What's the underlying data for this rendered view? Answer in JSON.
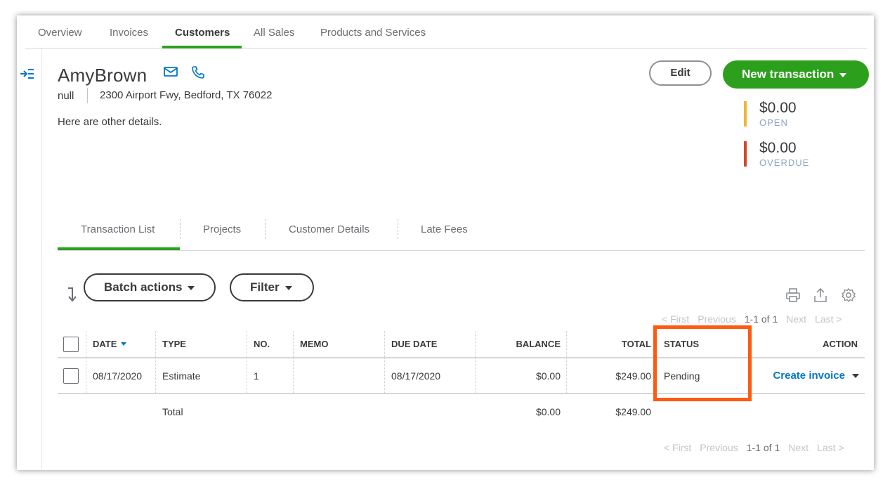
{
  "top_tabs": [
    {
      "label": "Overview"
    },
    {
      "label": "Invoices"
    },
    {
      "label": "Customers",
      "active": true
    },
    {
      "label": "All Sales"
    },
    {
      "label": "Products and Services"
    }
  ],
  "customer": {
    "name": "AmyBrown",
    "company": "null",
    "address": "2300 Airport Fwy, Bedford, TX 76022",
    "details": "Here are other details."
  },
  "actions": {
    "edit_label": "Edit",
    "new_transaction_label": "New transaction"
  },
  "balances": {
    "open": {
      "amount": "$0.00",
      "label": "OPEN",
      "color": "#f2b534"
    },
    "overdue": {
      "amount": "$0.00",
      "label": "OVERDUE",
      "color": "#d4472a"
    }
  },
  "sub_tabs": [
    {
      "label": "Transaction List",
      "active": true
    },
    {
      "label": "Projects"
    },
    {
      "label": "Customer Details"
    },
    {
      "label": "Late Fees"
    }
  ],
  "toolbar": {
    "batch_actions_label": "Batch actions",
    "filter_label": "Filter"
  },
  "pager": {
    "first": "< First",
    "previous": "Previous",
    "range": "1-1 of 1",
    "next": "Next",
    "last": "Last >"
  },
  "table": {
    "headers": [
      "DATE",
      "TYPE",
      "NO.",
      "MEMO",
      "DUE DATE",
      "BALANCE",
      "TOTAL",
      "STATUS",
      "ACTION"
    ],
    "rows": [
      {
        "date": "08/17/2020",
        "type": "Estimate",
        "no": "1",
        "memo": "",
        "due_date": "08/17/2020",
        "balance": "$0.00",
        "total": "$249.00",
        "status": "Pending",
        "action": "Create invoice"
      }
    ],
    "total_row": {
      "label": "Total",
      "balance": "$0.00",
      "total": "$249.00"
    }
  },
  "colors": {
    "accent_green": "#2ca01c",
    "link_blue": "#0077c5",
    "highlight_orange": "#ff5a13"
  }
}
